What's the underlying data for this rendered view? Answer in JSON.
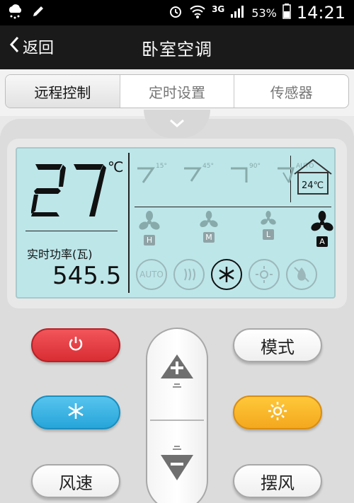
{
  "status_bar": {
    "battery_percent": "53%",
    "time": "14:21",
    "network": "3G",
    "icons": [
      "weather-icon",
      "edit-icon",
      "alarm-icon",
      "wifi-icon",
      "signal-icon",
      "battery-icon"
    ]
  },
  "header": {
    "back_label": "返回",
    "title": "卧室空调"
  },
  "tabs": [
    {
      "label": "远程控制",
      "active": true
    },
    {
      "label": "定时设置",
      "active": false
    },
    {
      "label": "传感器",
      "active": false
    }
  ],
  "lcd": {
    "temperature": "27",
    "temp_unit": "℃",
    "power_label": "实时功率(瓦)",
    "power_value": "545.5",
    "swing_angles": [
      "15°",
      "45°",
      "90°",
      "AUTO"
    ],
    "room_temp": "24℃",
    "fan_speeds": [
      {
        "letter": "H",
        "active": false
      },
      {
        "letter": "M",
        "active": false
      },
      {
        "letter": "L",
        "active": false
      },
      {
        "letter": "A",
        "active": true
      }
    ],
    "modes": [
      {
        "name": "auto",
        "label": "AUTO",
        "active": false
      },
      {
        "name": "heat",
        "label": "",
        "active": false
      },
      {
        "name": "cool",
        "label": "",
        "active": true
      },
      {
        "name": "sun",
        "label": "",
        "active": false
      },
      {
        "name": "dry",
        "label": "",
        "active": false
      }
    ]
  },
  "controls": {
    "mode_label": "模式",
    "fan_speed_label": "风速",
    "swing_label": "摆风"
  },
  "colors": {
    "lcd_background": "#bde6e9",
    "power_button": "#e33a3f",
    "cool_button": "#36b1e3",
    "heat_button": "#f8b62a"
  }
}
